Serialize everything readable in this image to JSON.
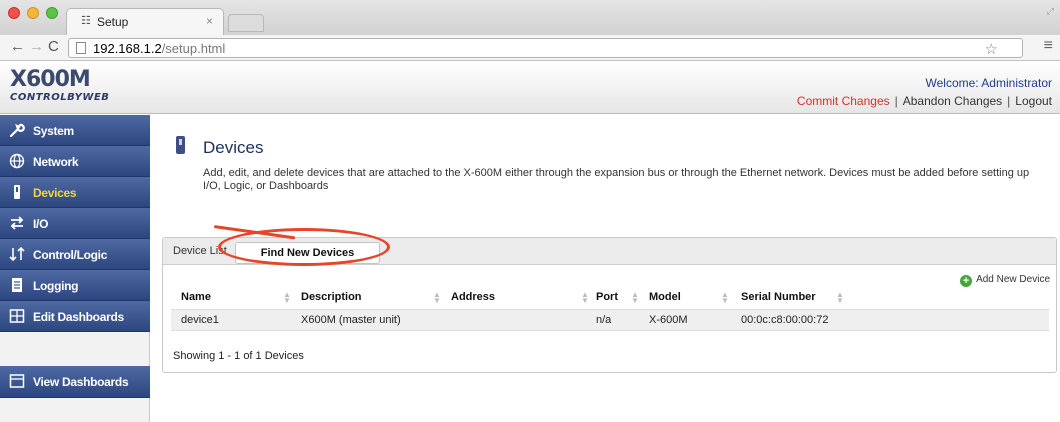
{
  "browser": {
    "tab_title": "Setup",
    "tab_close": "×",
    "url_host": "192.168.1.2",
    "url_path": "/setup.html",
    "back_glyph": "←",
    "forward_glyph": "→",
    "reload_glyph": "C",
    "star_glyph": "☆",
    "menu_glyph": "≡",
    "favicon_glyph": "☷",
    "resize_glyph": "⤢"
  },
  "header": {
    "logo_main": "X600M",
    "logo_sub": "CONTROLBYWEB",
    "welcome": "Welcome: Administrator",
    "links": {
      "commit": "Commit Changes",
      "abandon": "Abandon Changes",
      "logout": "Logout",
      "separator": "|"
    }
  },
  "sidebar": {
    "items": [
      {
        "label": "System",
        "icon": "wrench-icon",
        "glyph": "🔧"
      },
      {
        "label": "Network",
        "icon": "globe-icon",
        "glyph": "⊕"
      },
      {
        "label": "Devices",
        "icon": "device-icon",
        "glyph": "▮"
      },
      {
        "label": "I/O",
        "icon": "arrows-icon",
        "glyph": "⇄"
      },
      {
        "label": "Control/Logic",
        "icon": "logic-icon",
        "glyph": "⇅"
      },
      {
        "label": "Logging",
        "icon": "list-icon",
        "glyph": "☰"
      },
      {
        "label": "Edit Dashboards",
        "icon": "dashboard-icon",
        "glyph": "⊟"
      }
    ],
    "view_dashboards": {
      "label": "View Dashboards",
      "icon": "dashboard-icon",
      "glyph": "⊟"
    },
    "active_index": 2,
    "active_color": "#f7d23a"
  },
  "main": {
    "title": "Devices",
    "description": "Add, edit, and delete devices that are attached to the X-600M either through the expansion bus or through the Ethernet network. Devices must be added before setting up I/O, Logic, or Dashboards",
    "tabs": {
      "device_list": "Device List",
      "find_new": "Find New Devices"
    },
    "add_device": "Add New Device",
    "table": {
      "headers": [
        "Name",
        "Description",
        "Address",
        "Port",
        "Model",
        "Serial Number"
      ],
      "rows": [
        [
          "device1",
          "X600M (master unit)",
          "",
          "n/a",
          "X-600M",
          "00:0c:c8:00:00:72"
        ]
      ]
    },
    "showing": "Showing 1 - 1 of 1 Devices"
  },
  "colors": {
    "nav_blue": "#3a5590",
    "accent_red": "#d0332b",
    "highlight": "#e6452a"
  }
}
